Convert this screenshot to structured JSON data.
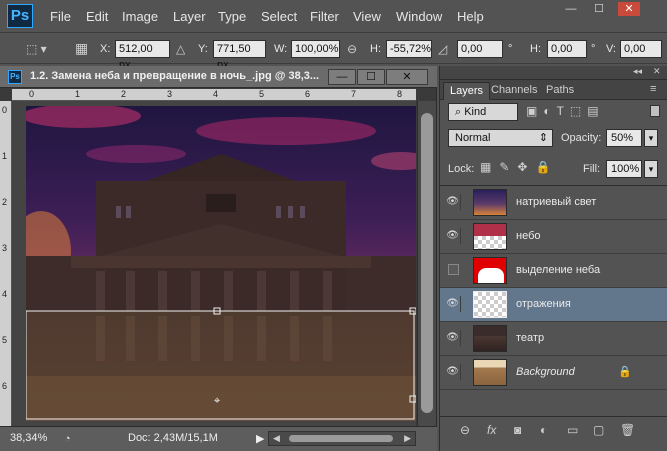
{
  "app": {
    "logo": "Ps"
  },
  "menu": [
    "File",
    "Edit",
    "Image",
    "Layer",
    "Type",
    "Select",
    "Filter",
    "View",
    "Window",
    "Help"
  ],
  "window_controls": {
    "minimize": "—",
    "maximize": "☐",
    "close": "✕"
  },
  "options": {
    "x_label": "X:",
    "x_value": "512,00 px",
    "y_label": "Y:",
    "y_value": "771,50 px",
    "w_label": "W:",
    "w_value": "100,00%",
    "h_label": "H:",
    "h_value": "-55,72%",
    "angle_value": "0,00",
    "angle_unit": "°",
    "hskew_label": "H:",
    "hskew_value": "0,00",
    "hskew_unit": "°",
    "vskew_label": "V:",
    "vskew_value": "0,00"
  },
  "document": {
    "title": "1.2. Замена неба и превращение в ночь_.jpg @ 38,3...",
    "ruler_h": [
      "0",
      "1",
      "2",
      "3",
      "4",
      "5",
      "6",
      "7",
      "8"
    ],
    "ruler_v": [
      "0",
      "1",
      "2",
      "3",
      "4",
      "5",
      "6"
    ],
    "zoom": "38,34%",
    "doc_info": "Doc: 2,43M/15,1M"
  },
  "panel": {
    "tabs": [
      "Layers",
      "Channels",
      "Paths"
    ],
    "filter_kind": "Kind",
    "blend_mode": "Normal",
    "opacity_label": "Opacity:",
    "opacity_value": "50%",
    "lock_label": "Lock:",
    "fill_label": "Fill:",
    "fill_value": "100%",
    "layers": [
      {
        "name": "натриевый свет",
        "visible": true
      },
      {
        "name": "небо",
        "visible": true
      },
      {
        "name": "выделение неба",
        "visible": false
      },
      {
        "name": "отражения",
        "visible": true,
        "selected": true
      },
      {
        "name": "театр",
        "visible": true
      },
      {
        "name": "Background",
        "visible": true,
        "locked": true
      }
    ]
  }
}
